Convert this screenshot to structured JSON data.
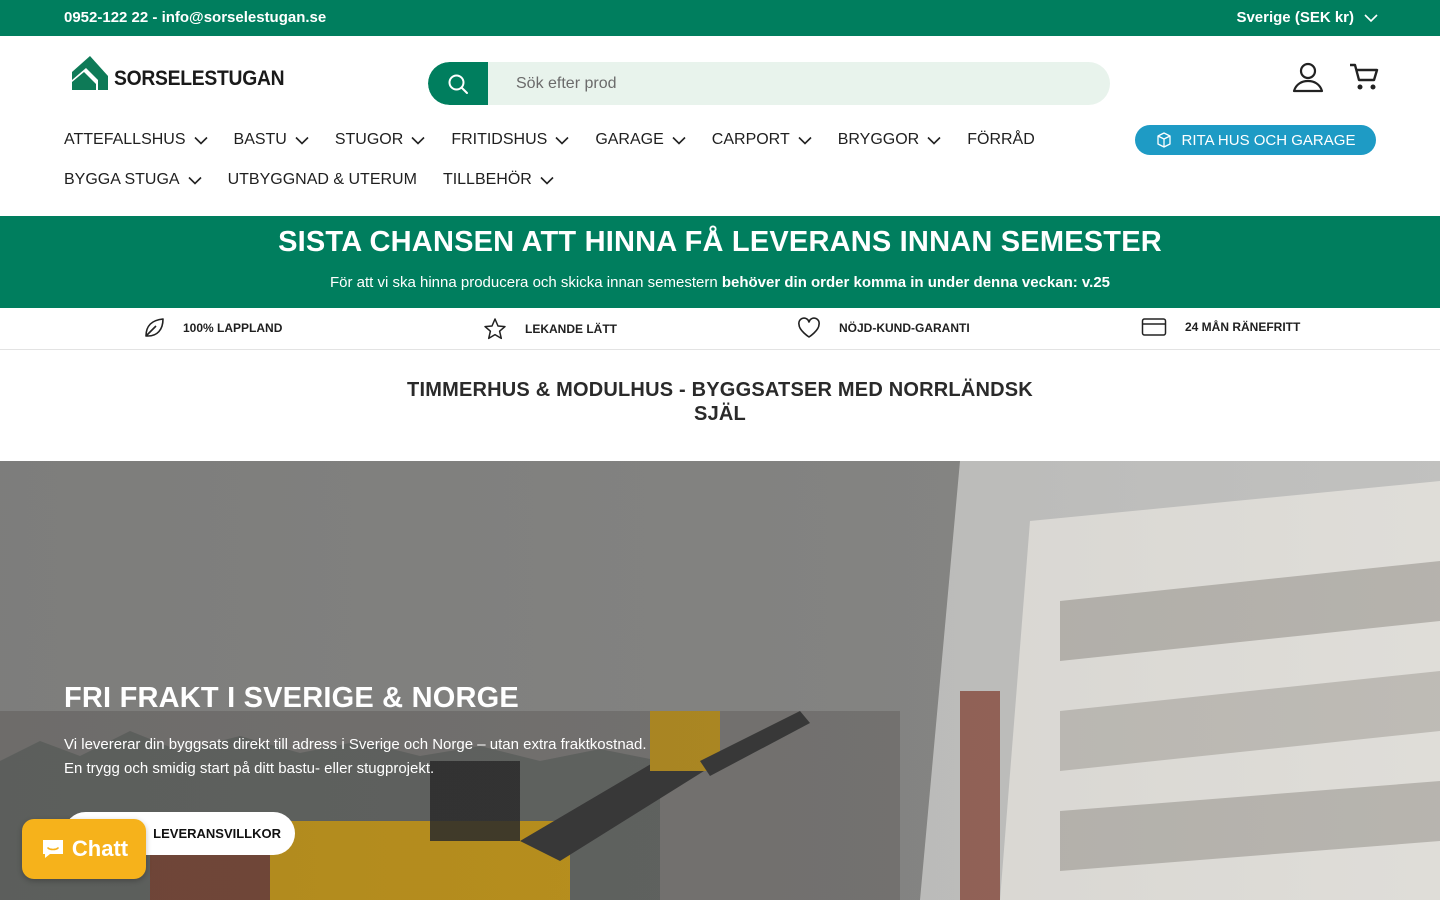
{
  "topbar": {
    "contact": "0952-122 22 - info@sorselestugan.se",
    "region": "Sverige (SEK kr)"
  },
  "brand": {
    "name": "SORSELESTUGAN",
    "color": "#007e5e"
  },
  "search": {
    "placeholder": "Sök efter prod"
  },
  "nav": {
    "items": [
      {
        "label": "ATTEFALLSHUS",
        "dropdown": true
      },
      {
        "label": "BASTU",
        "dropdown": true
      },
      {
        "label": "STUGOR",
        "dropdown": true
      },
      {
        "label": "FRITIDSHUS",
        "dropdown": true
      },
      {
        "label": "GARAGE",
        "dropdown": true
      },
      {
        "label": "CARPORT",
        "dropdown": true
      },
      {
        "label": "BRYGGOR",
        "dropdown": true
      },
      {
        "label": "FÖRRÅD",
        "dropdown": false
      },
      {
        "label": "BYGGA STUGA",
        "dropdown": true
      },
      {
        "label": "UTBYGGNAD & UTERUM",
        "dropdown": false
      },
      {
        "label": "TILLBEHÖR",
        "dropdown": true
      }
    ],
    "rita_label": "RITA HUS OCH GARAGE",
    "rita_color": "#1e9bc5"
  },
  "promo": {
    "headline": "SISTA CHANSEN ATT HINNA FÅ LEVERANS INNAN SEMESTER",
    "text": "För att vi ska hinna producera och skicka innan semestern ",
    "text_bold": "behöver din order komma in under denna veckan: v.25"
  },
  "usps": [
    {
      "label": "100% LAPPLAND",
      "icon": "leaf-icon"
    },
    {
      "label": "LEKANDE LÄTT",
      "icon": "star-icon"
    },
    {
      "label": "NÖJD-KUND-GARANTI",
      "icon": "heart-icon"
    },
    {
      "label": "24 MÅN RÄNEFRITT",
      "icon": "credit-card-icon"
    }
  ],
  "tagline": {
    "line1": "TIMMERHUS & MODULHUS - BYGGSATSER MED NORRLÄNDSK",
    "line2": "SJÄL"
  },
  "hero": {
    "title": "FRI FRAKT I SVERIGE & NORGE",
    "line1": "Vi levererar din byggsats direkt till adress i Sverige och Norge – utan extra fraktkostnad.",
    "line2": "En trygg och smidig start på ditt bastu- eller stugprojekt.",
    "cta": "LEVERANSVILLKOR"
  },
  "chat": {
    "label": "Chatt",
    "color": "#f6b21b"
  }
}
